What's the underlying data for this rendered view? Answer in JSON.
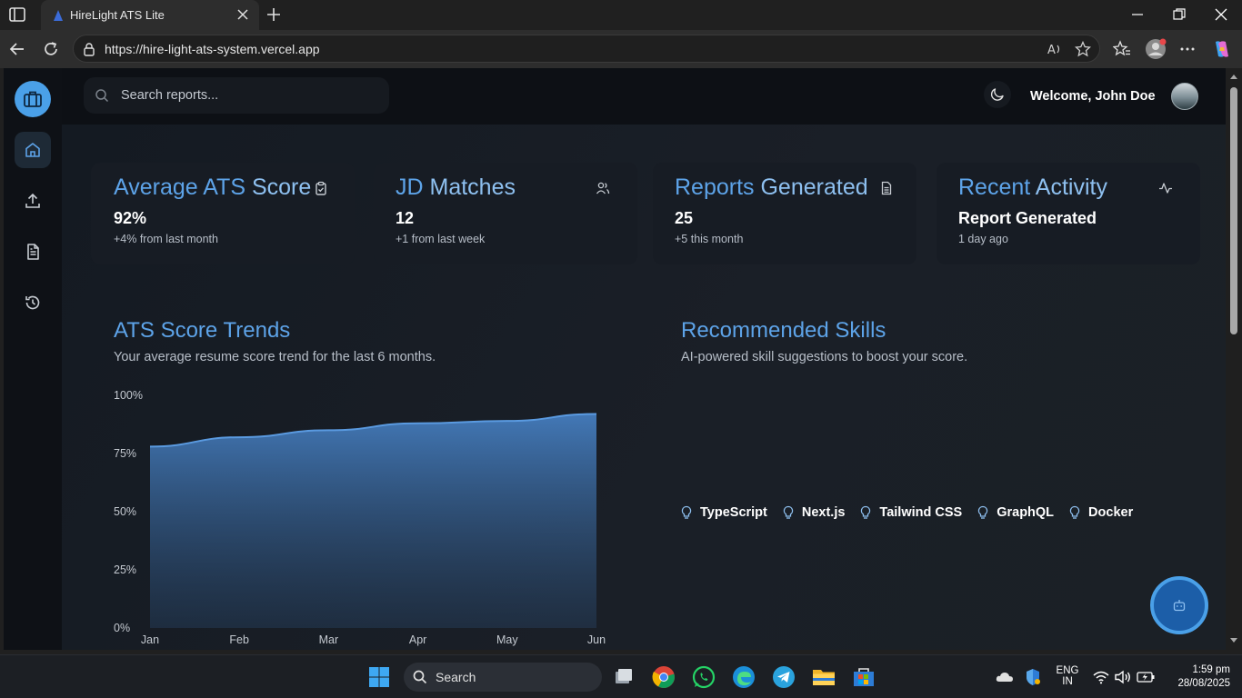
{
  "browser": {
    "tab_title": "HireLight ATS Lite",
    "url": "https://hire-light-ats-system.vercel.app"
  },
  "topbar": {
    "search_placeholder": "Search reports...",
    "welcome": "Welcome, John Doe"
  },
  "cards": [
    {
      "title_a": "Average ATS ",
      "title_b": "Score",
      "icon": "clipboard-check-icon",
      "value": "92%",
      "sub": "+4% from last month"
    },
    {
      "title_a": "JD ",
      "title_b": "Matches",
      "icon": "users-icon",
      "value": "12",
      "sub": "+1 from last week"
    },
    {
      "title_a": "Reports ",
      "title_b": "Generated",
      "icon": "file-text-icon",
      "value": "25",
      "sub": "+5 this month"
    },
    {
      "title_a": "Recent ",
      "title_b": "Activity",
      "icon": "activity-icon",
      "value": "Report Generated",
      "sub": "1 day ago"
    }
  ],
  "chart_section": {
    "title": "ATS Score Trends",
    "subtitle": "Your average resume score trend for the last 6 months."
  },
  "skills_section": {
    "title": "Recommended Skills",
    "subtitle": "AI-powered skill suggestions to boost your score.",
    "skills": [
      "TypeScript",
      "Next.js",
      "Tailwind CSS",
      "GraphQL",
      "Docker"
    ]
  },
  "chart_data": {
    "type": "area",
    "x": [
      "Jan",
      "Feb",
      "Mar",
      "Apr",
      "May",
      "Jun"
    ],
    "series": [
      {
        "values": [
          78,
          82,
          85,
          88,
          89,
          92
        ]
      }
    ],
    "ylim": [
      0,
      100
    ],
    "yticks": [
      "0%",
      "25%",
      "50%",
      "75%",
      "100%"
    ],
    "grid": false,
    "color": "#4a88d0"
  },
  "taskbar": {
    "search_label": "Search",
    "lang_top": "ENG",
    "lang_bottom": "IN",
    "time": "1:59 pm",
    "date": "28/08/2025"
  },
  "colors": {
    "accent": "#5da3e8",
    "background": "#12161c"
  }
}
